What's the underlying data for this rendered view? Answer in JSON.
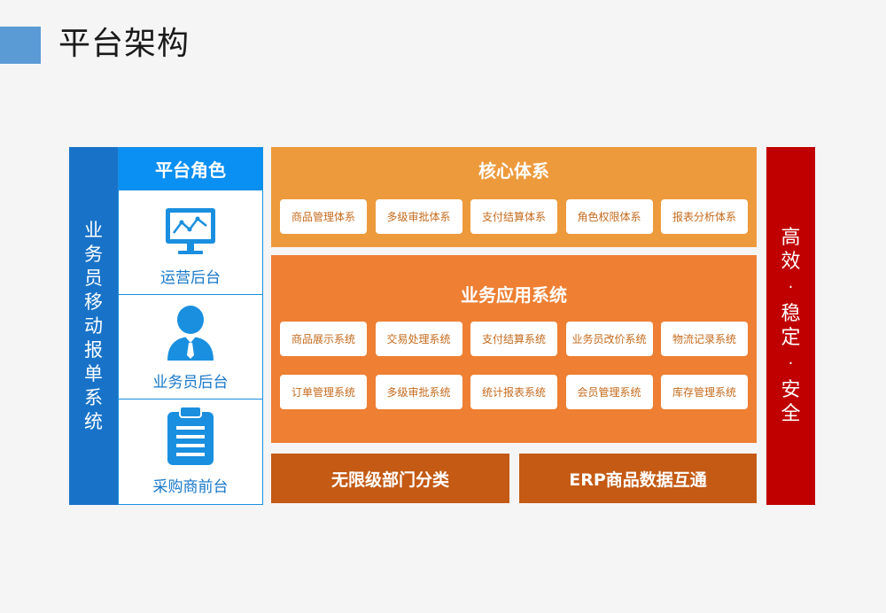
{
  "title": "平台架构",
  "left_column": {
    "text": [
      "业",
      "务",
      "员",
      "移",
      "动",
      "报",
      "单",
      "系",
      "统"
    ]
  },
  "roles": {
    "header": "平台角色",
    "items": [
      {
        "label": "运营后台",
        "icon": "monitor-chart-icon"
      },
      {
        "label": "业务员后台",
        "icon": "salesperson-icon"
      },
      {
        "label": "采购商前台",
        "icon": "clipboard-icon"
      }
    ]
  },
  "core": {
    "title": "核心体系",
    "chips": [
      "商品管理体系",
      "多级审批体系",
      "支付结算体系",
      "角色权限体系",
      "报表分析体系"
    ]
  },
  "business": {
    "title": "业务应用系统",
    "row1": [
      "商品展示系统",
      "交易处理系统",
      "支付结算系统",
      "业务员改价系统",
      "物流记录系统"
    ],
    "row2": [
      "订单管理系统",
      "多级审批系统",
      "统计报表系统",
      "会员管理系统",
      "库存管理系统"
    ]
  },
  "bottom": {
    "left": "无限级部门分类",
    "right": "ERP商品数据互通"
  },
  "right_column": {
    "text": [
      "高",
      "效",
      "·",
      "稳",
      "定",
      "·",
      "安",
      "全"
    ]
  },
  "colors": {
    "accent_bar": "#5b9bd5",
    "left_column": "#1873c8",
    "roles_header": "#0a8ff2",
    "core": "#ed9a3c",
    "business": "#ee7f33",
    "bottom": "#c45a14",
    "right_column": "#c00000"
  }
}
